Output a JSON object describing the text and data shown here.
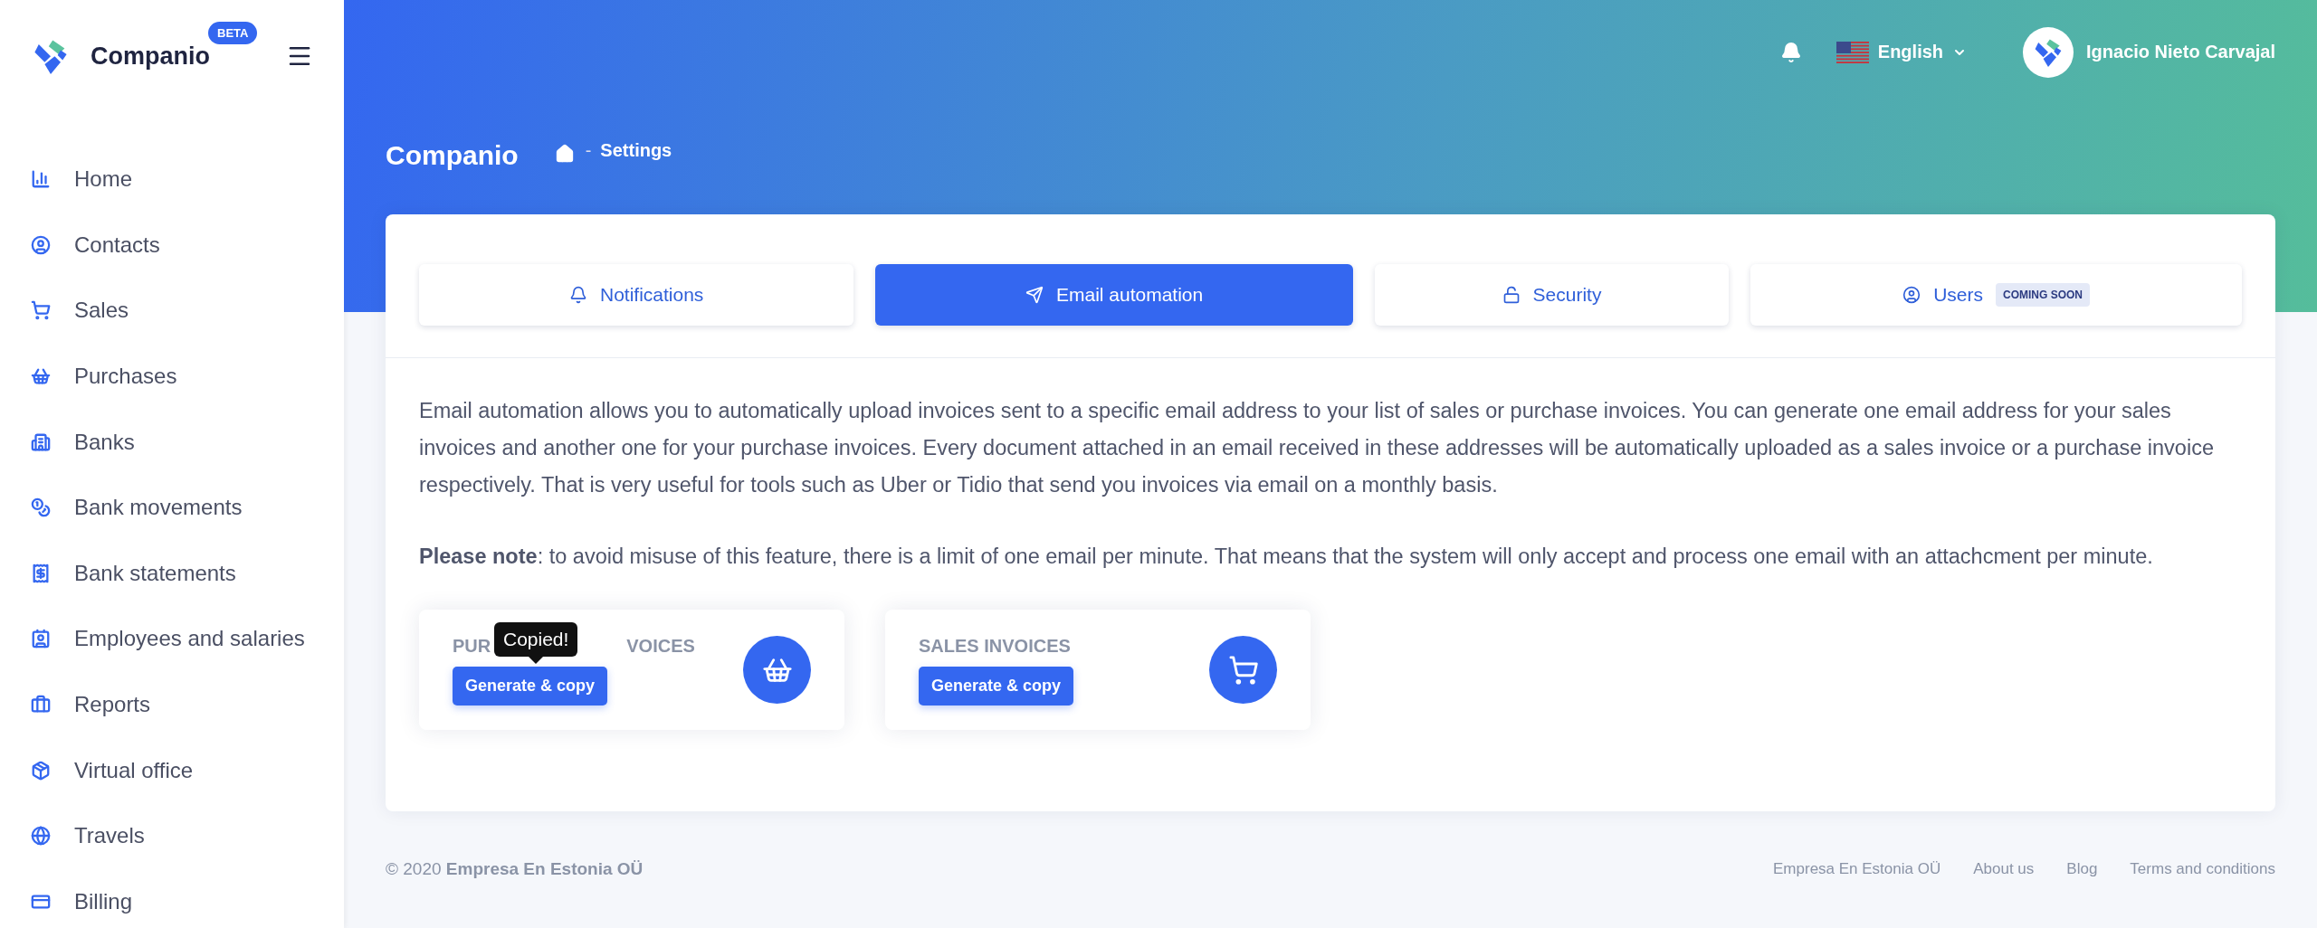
{
  "sidebar": {
    "brand": "Companio",
    "badge": "BETA",
    "items": [
      {
        "label": "Home"
      },
      {
        "label": "Contacts"
      },
      {
        "label": "Sales"
      },
      {
        "label": "Purchases"
      },
      {
        "label": "Banks"
      },
      {
        "label": "Bank movements"
      },
      {
        "label": "Bank statements"
      },
      {
        "label": "Employees and salaries"
      },
      {
        "label": "Reports"
      },
      {
        "label": "Virtual office"
      },
      {
        "label": "Travels"
      },
      {
        "label": "Billing"
      }
    ]
  },
  "topbar": {
    "language": "English",
    "user": "Ignacio Nieto Carvajal"
  },
  "page": {
    "title": "Companio",
    "breadcrumb_separator": "-",
    "breadcrumb": "Settings"
  },
  "tabs": [
    {
      "label": "Notifications",
      "selected": false
    },
    {
      "label": "Email automation",
      "selected": true
    },
    {
      "label": "Security",
      "selected": false
    },
    {
      "label": "Users",
      "selected": false,
      "badge": "COMING SOON"
    }
  ],
  "description": "Email automation allows you to automatically upload invoices sent to a specific email address to your list of sales or purchase invoices. You can generate one email address for your sales invoices and another one for your purchase invoices. Every document attached in an email received in these addresses will be automatically uploaded as a sales invoice or a purchase invoice respectively. That is very useful for tools such as Uber or Tidio that send you invoices via email on a monthly basis.",
  "note": "**Please note**: to avoid misuse of this feature, there is a limit of one email per minute. That means that the system will only accept and process one email with an attachcment per minute.",
  "invoice_cards": [
    {
      "title_parts": [
        "PUR",
        "VOICES"
      ],
      "button": "Generate & copy",
      "tooltip": "Copied!"
    },
    {
      "title_parts": [
        "SALES INVOICES"
      ],
      "button": "Generate & copy"
    }
  ],
  "footer": {
    "copyright": "© 2020  **Empresa En Estonia OÜ**",
    "links": [
      "Empresa En Estonia OÜ",
      "About us",
      "Blog",
      "Terms and conditions"
    ]
  }
}
